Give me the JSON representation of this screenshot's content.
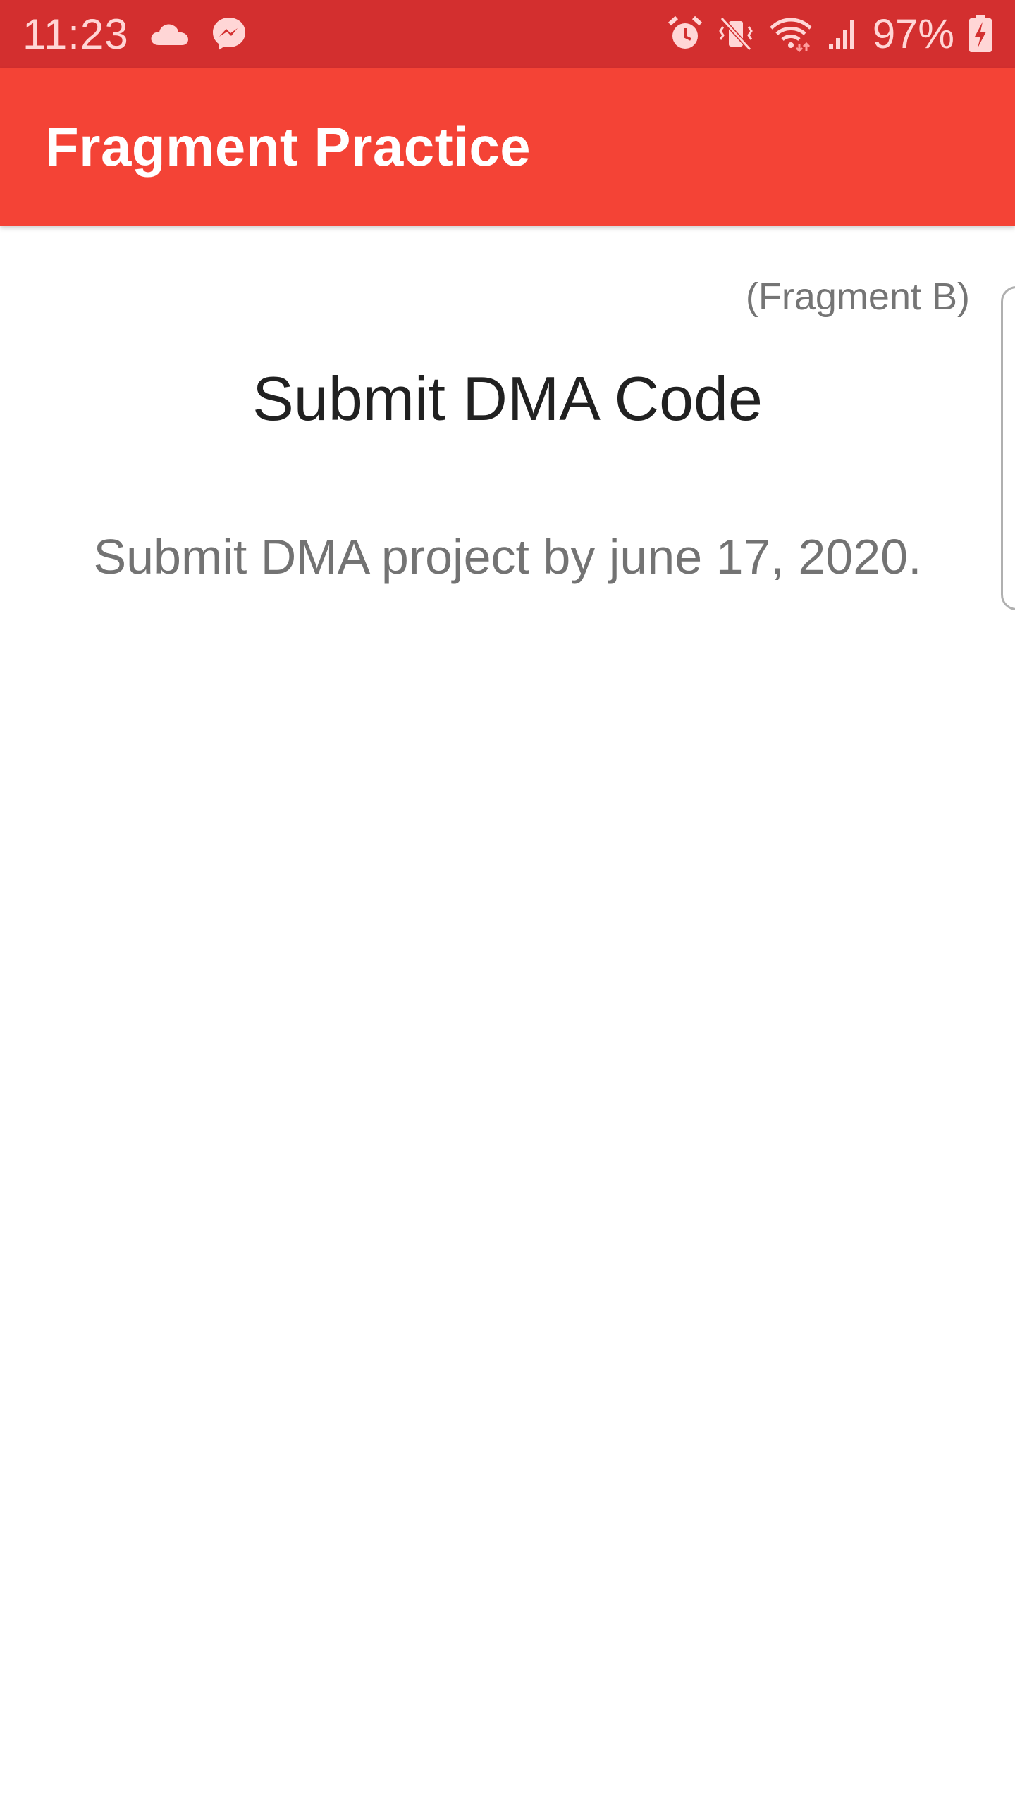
{
  "status_bar": {
    "time": "11:23",
    "battery_percent": "97%",
    "left_icons": [
      "cloud-icon",
      "messenger-icon"
    ],
    "right_icons": [
      "alarm-icon",
      "vibrate-mute-icon",
      "wifi-icon",
      "signal-icon",
      "battery-charging-icon"
    ]
  },
  "app_bar": {
    "title": "Fragment Practice"
  },
  "fragment": {
    "label": "(Fragment B)",
    "heading": "Submit DMA Code",
    "body": "Submit DMA project by june 17, 2020."
  },
  "colors": {
    "status_bar_bg": "#d32f2f",
    "app_bar_bg": "#f44336",
    "heading_text": "#212121",
    "secondary_text": "#757575"
  }
}
